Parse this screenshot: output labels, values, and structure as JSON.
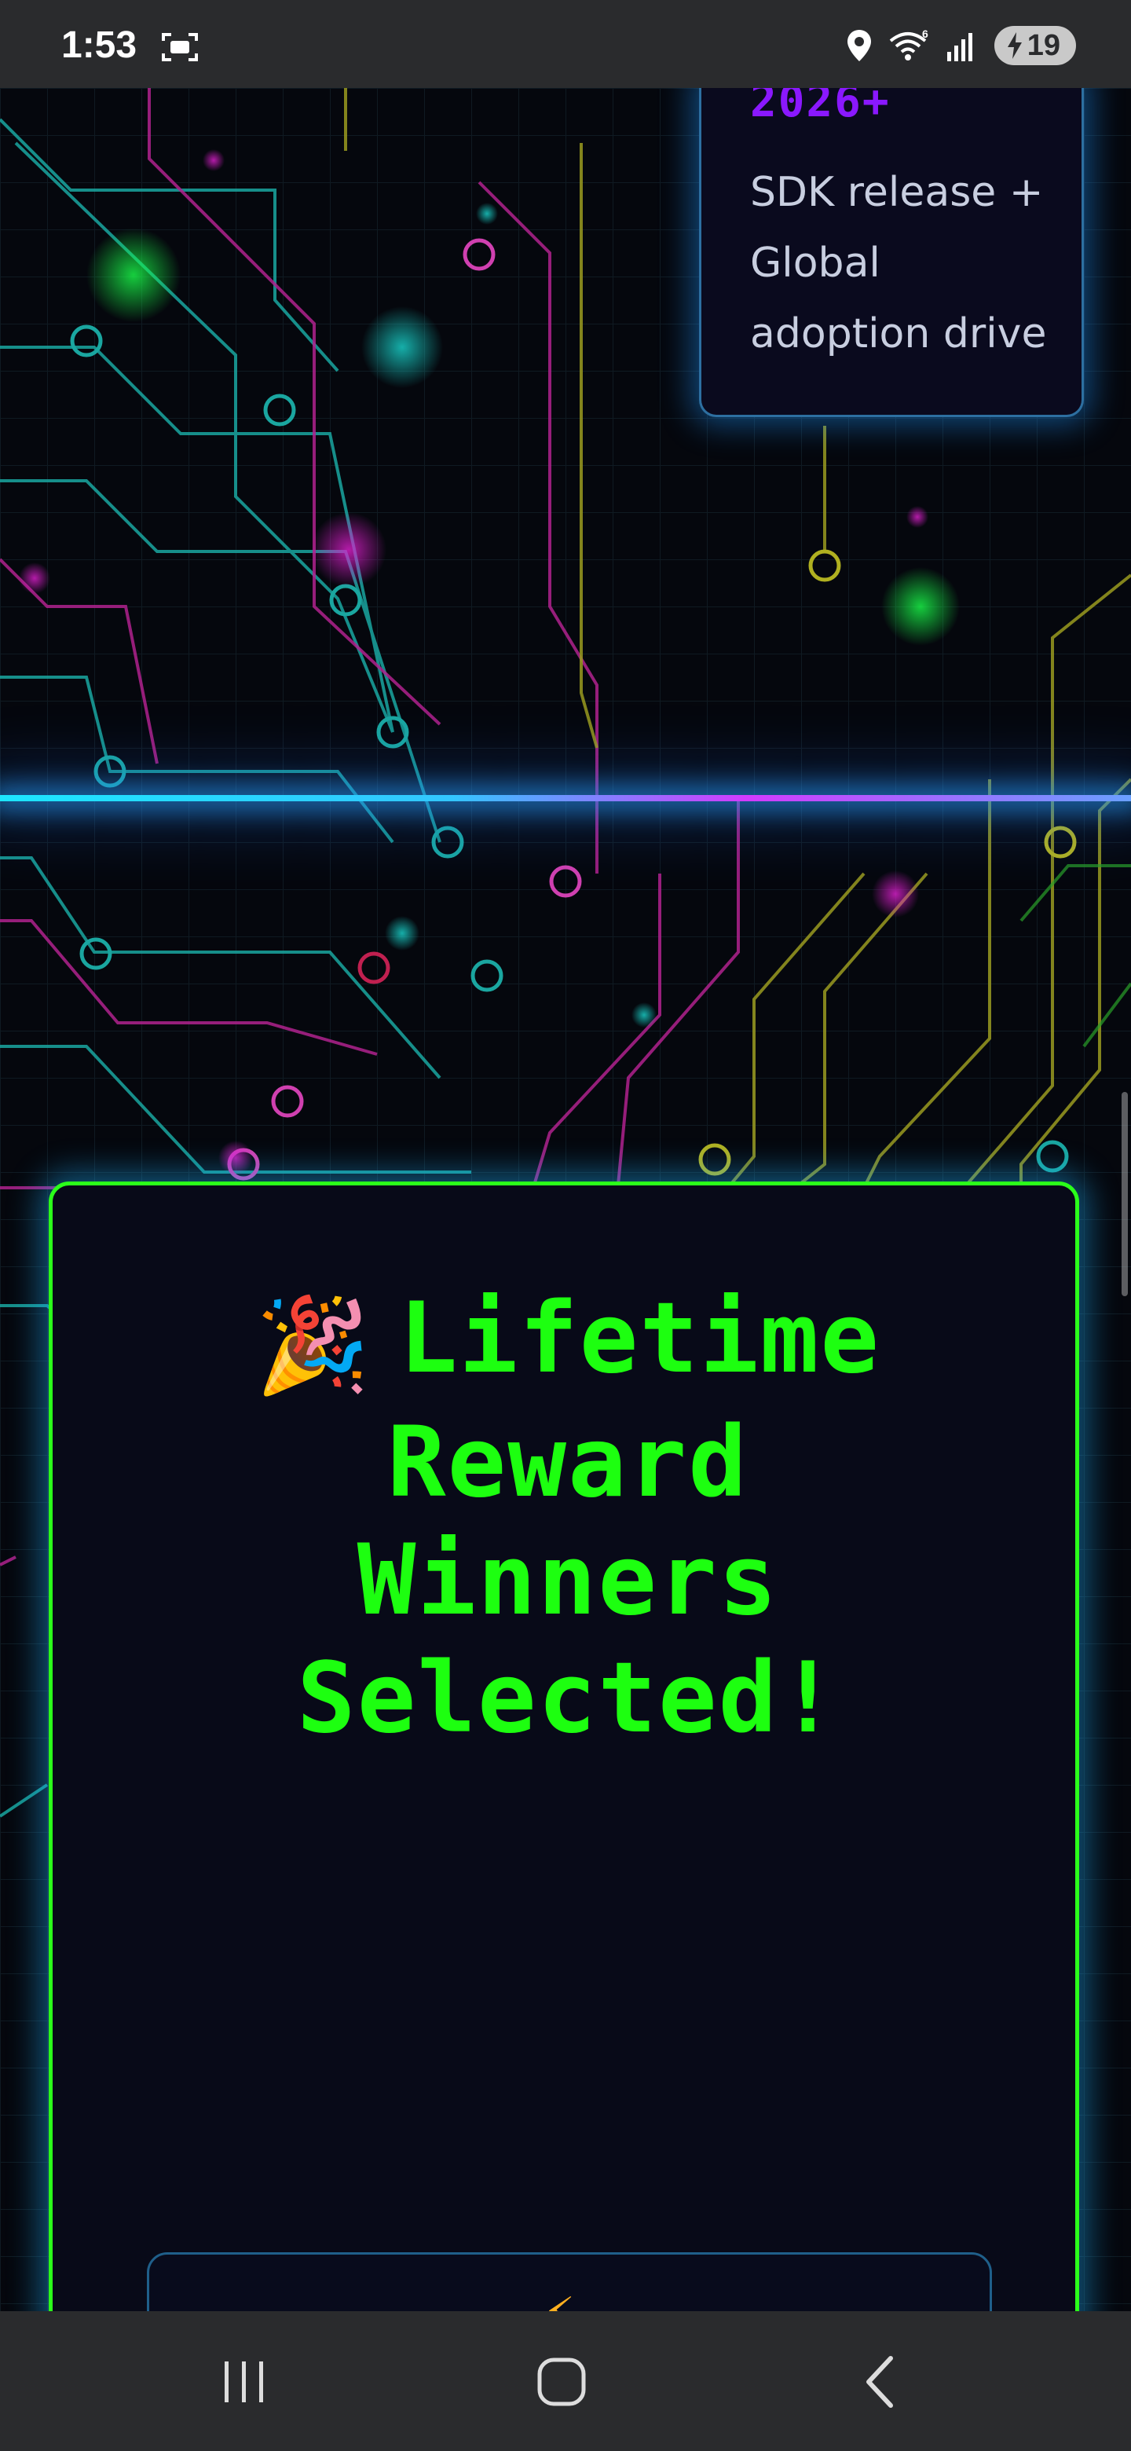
{
  "status_bar": {
    "time": "1:53",
    "battery_level": "19",
    "icons": [
      "screen-record-icon",
      "location-icon",
      "wifi-6-icon",
      "signal-icon",
      "battery-charging-icon"
    ]
  },
  "roadmap": {
    "year": "2026+",
    "description": "SDK release + Global adoption drive"
  },
  "winners": {
    "emoji": "🎉",
    "title": "Lifetime Reward Winners Selected!",
    "inner_emoji": "⚡"
  },
  "colors": {
    "accent_green": "#1dff10",
    "accent_purple": "#8a18ff",
    "glow_blue": "#1de5ff",
    "background": "#05070d"
  },
  "nav_bar": {
    "buttons": [
      "recent-apps-icon",
      "home-icon",
      "back-icon"
    ]
  }
}
